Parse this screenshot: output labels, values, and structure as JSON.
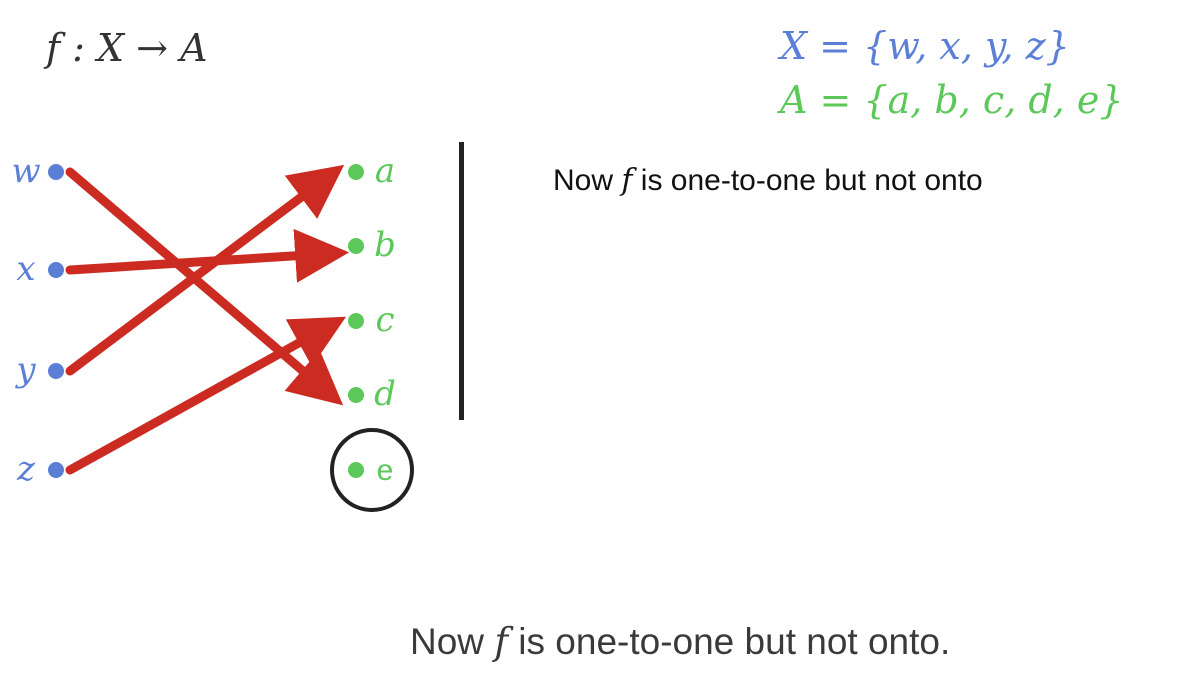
{
  "header": {
    "function_sig": "f : X → A"
  },
  "sets": {
    "x_def": "X = {w, x, y, z}",
    "a_def": "A = {a, b, c, d, e}"
  },
  "diagram": {
    "domain": [
      {
        "label": "w"
      },
      {
        "label": "x"
      },
      {
        "label": "y"
      },
      {
        "label": "z"
      }
    ],
    "codomain": [
      {
        "label": "a"
      },
      {
        "label": "b"
      },
      {
        "label": "c"
      },
      {
        "label": "d"
      },
      {
        "label": "e"
      }
    ],
    "mapping": [
      {
        "from": "w",
        "to": "d"
      },
      {
        "from": "x",
        "to": "b"
      },
      {
        "from": "y",
        "to": "a"
      },
      {
        "from": "z",
        "to": "c"
      }
    ],
    "highlighted": "e"
  },
  "side_note": {
    "prefix": "Now ",
    "f": "f",
    "suffix": " is one-to-one but not onto"
  },
  "caption": {
    "prefix": "Now ",
    "f": "f",
    "suffix": " is one-to-one but not onto."
  },
  "colors": {
    "domain": "#5b7fd6",
    "codomain": "#5cc85a",
    "arrow": "#cc2b22",
    "circle": "#222222"
  }
}
